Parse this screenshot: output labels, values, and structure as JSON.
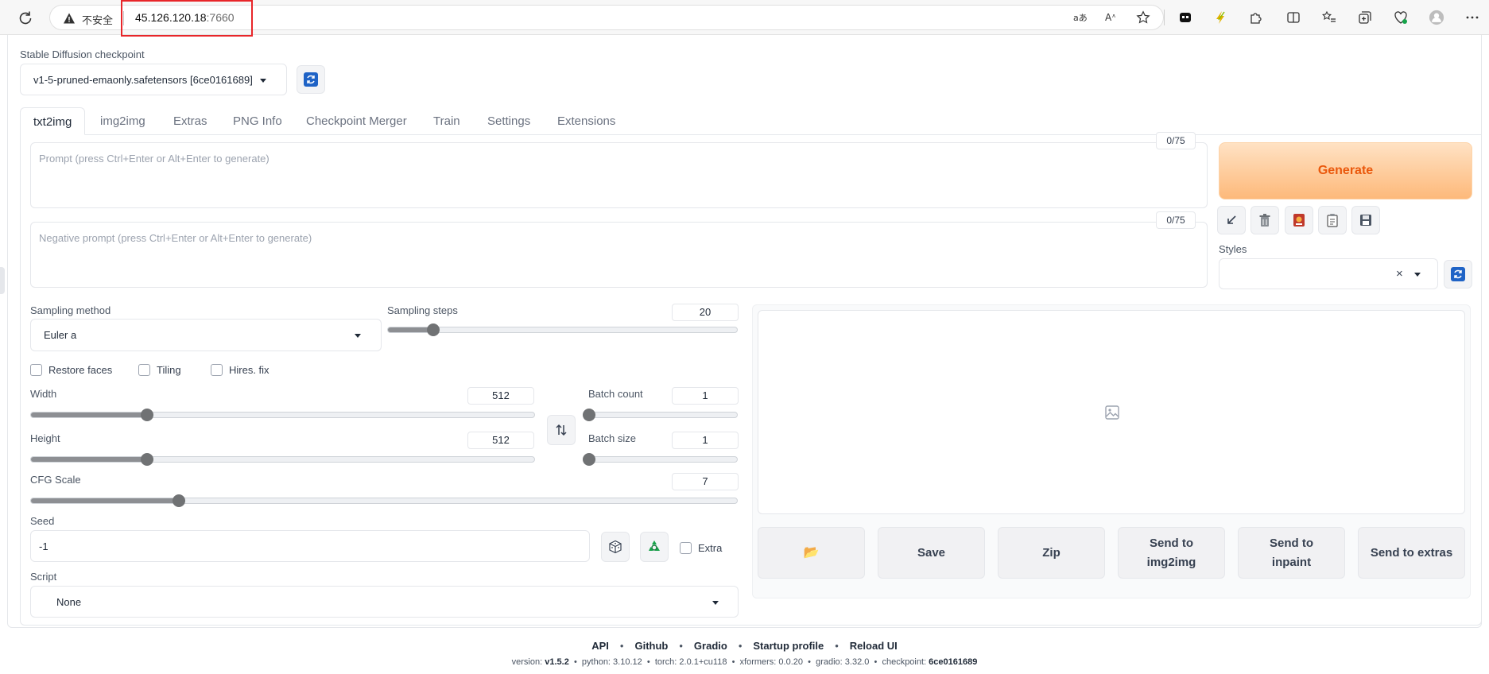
{
  "browser": {
    "insecure_label": "不安全",
    "url_host": "45.126.120.18",
    "url_port": ":7660"
  },
  "checkpoint": {
    "label": "Stable Diffusion checkpoint",
    "value": "v1-5-pruned-emaonly.safetensors [6ce0161689]"
  },
  "tabs": [
    {
      "label": "txt2img",
      "active": true
    },
    {
      "label": "img2img"
    },
    {
      "label": "Extras"
    },
    {
      "label": "PNG Info"
    },
    {
      "label": "Checkpoint Merger"
    },
    {
      "label": "Train"
    },
    {
      "label": "Settings"
    },
    {
      "label": "Extensions"
    }
  ],
  "prompt": {
    "placeholder": "Prompt (press Ctrl+Enter or Alt+Enter to generate)",
    "token_count": "0/75"
  },
  "negative_prompt": {
    "placeholder": "Negative prompt (press Ctrl+Enter or Alt+Enter to generate)",
    "token_count": "0/75"
  },
  "generate_label": "Generate",
  "styles": {
    "label": "Styles",
    "clear_glyph": "×"
  },
  "sampling": {
    "method_label": "Sampling method",
    "method_value": "Euler a",
    "steps_label": "Sampling steps",
    "steps_value": "20",
    "steps_fraction": 0.13
  },
  "checkboxes": {
    "restore_faces": "Restore faces",
    "tiling": "Tiling",
    "hires_fix": "Hires. fix"
  },
  "width": {
    "label": "Width",
    "value": "512",
    "fraction": 0.23
  },
  "height": {
    "label": "Height",
    "value": "512",
    "fraction": 0.23
  },
  "batch_count": {
    "label": "Batch count",
    "value": "1",
    "fraction": 0.0
  },
  "batch_size": {
    "label": "Batch size",
    "value": "1",
    "fraction": 0.0
  },
  "cfg_scale": {
    "label": "CFG Scale",
    "value": "7",
    "fraction": 0.21
  },
  "seed": {
    "label": "Seed",
    "value": "-1",
    "extra_label": "Extra"
  },
  "script": {
    "label": "Script",
    "value": "None"
  },
  "output_buttons": {
    "folder_glyph": "📂",
    "save": "Save",
    "zip": "Zip",
    "send_img2img": "Send to img2img",
    "send_inpaint": "Send to inpaint",
    "send_extras": "Send to extras"
  },
  "footer": {
    "links": [
      "API",
      "Github",
      "Gradio",
      "Startup profile",
      "Reload UI"
    ],
    "version_label": "version: ",
    "version": "v1.5.2",
    "python": "python: 3.10.12",
    "torch": "torch: 2.0.1+cu118",
    "xformers": "xformers: 0.0.20",
    "gradio": "gradio: 3.32.0",
    "checkpoint_label": "checkpoint: ",
    "checkpoint": "6ce0161689"
  }
}
